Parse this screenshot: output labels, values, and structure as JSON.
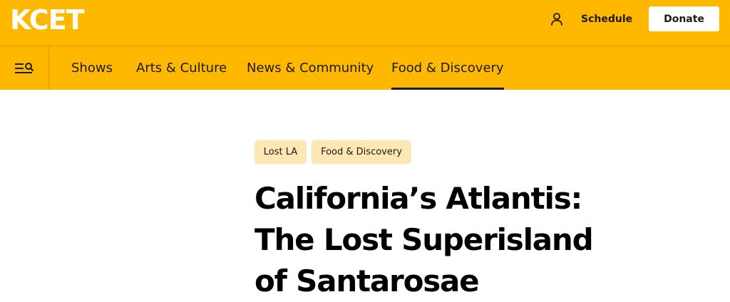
{
  "header": {
    "logo": "KCET",
    "schedule_label": "Schedule",
    "donate_label": "Donate",
    "brand_color": "#FFB800"
  },
  "nav": {
    "items": [
      {
        "label": "Shows"
      },
      {
        "label": "Arts & Culture"
      },
      {
        "label": "News & Community"
      },
      {
        "label": "Food & Discovery",
        "active": true
      }
    ]
  },
  "article": {
    "tags": [
      "Lost LA",
      "Food & Discovery"
    ],
    "title_lines": [
      "California’s Atlantis:",
      "The Lost Superisland",
      "of Santarosae"
    ]
  },
  "icons": [
    "user-icon",
    "menu-search-icon"
  ]
}
